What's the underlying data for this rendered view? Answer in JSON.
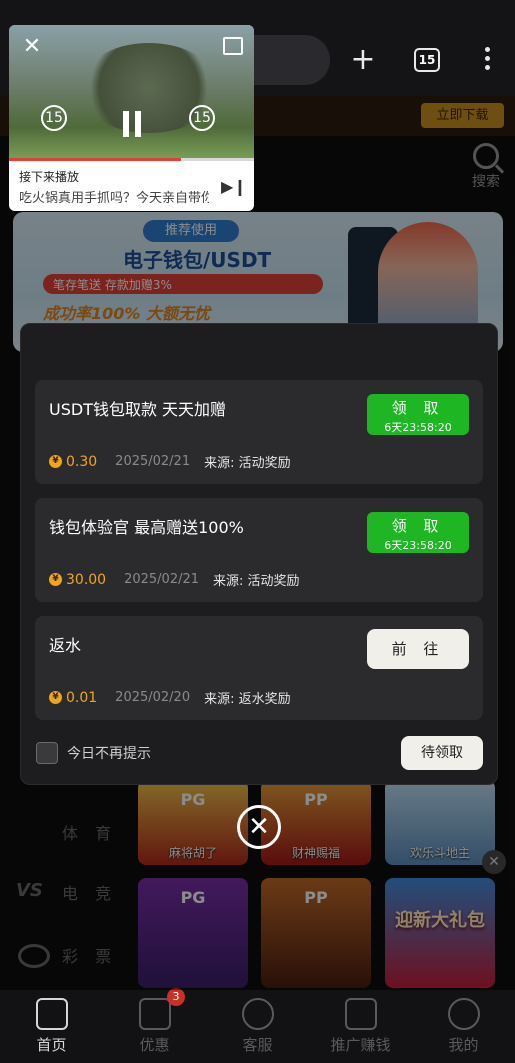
{
  "browser": {
    "tab_count": "15"
  },
  "mini_player": {
    "up_next_label": "接下来播放",
    "up_next_title": "吃火锅真用手抓吗？今天亲自带你",
    "replay_label": "15",
    "forward_label": "15",
    "progress": 0.7
  },
  "page": {
    "download_label": "立即下载",
    "search_label": "搜索",
    "banner": {
      "tag": "推荐使用",
      "title": "电子钱包/USDT",
      "subtitle": "笔存笔送 存款加赠3%",
      "rate_text": "成功率100% 大额无忧"
    },
    "side_categories": [
      "体 育",
      "电 竞",
      "彩 票"
    ],
    "games": [
      {
        "title": "麻将胡了",
        "label": "麻将胡了",
        "brand": "PG"
      },
      {
        "title": "财神赐福",
        "label": "财神赐福",
        "brand": "PP"
      },
      {
        "title": "",
        "label": "欢乐斗地主",
        "brand": ""
      },
      {
        "title": "",
        "label": "",
        "brand": "PG"
      },
      {
        "title": "",
        "label": "",
        "brand": "PP"
      },
      {
        "title": "迎新大礼包",
        "label": "",
        "brand": ""
      }
    ]
  },
  "modal": {
    "cards": [
      {
        "title": "USDT钱包取款 天天加赠",
        "button": "领 取",
        "timer": "6天23:58:20",
        "amount": "0.30",
        "date": "2025/02/21",
        "source": "来源: 活动奖励"
      },
      {
        "title": "钱包体验官 最高赠送100%",
        "button": "领 取",
        "timer": "6天23:58:20",
        "amount": "30.00",
        "date": "2025/02/21",
        "source": "来源: 活动奖励"
      },
      {
        "title": "返水",
        "button": "前 往",
        "amount": "0.01",
        "date": "2025/02/20",
        "source": "来源: 返水奖励"
      }
    ],
    "coin_symbol": "¥",
    "dont_show_today": "今日不再提示",
    "pending_button": "待领取"
  },
  "bottom_nav": {
    "items": [
      {
        "label": "首页",
        "icon": "home-icon",
        "active": true
      },
      {
        "label": "优惠",
        "icon": "gift-icon",
        "badge": "3"
      },
      {
        "label": "客服",
        "icon": "headset-icon"
      },
      {
        "label": "推广赚钱",
        "icon": "share-icon"
      },
      {
        "label": "我的",
        "icon": "user-icon"
      }
    ]
  },
  "colors": {
    "claim_green": "#1fb624",
    "amount_gold": "#f0a61c",
    "modal_bg": "#1d1d1f",
    "card_bg": "#2b2b2d"
  }
}
